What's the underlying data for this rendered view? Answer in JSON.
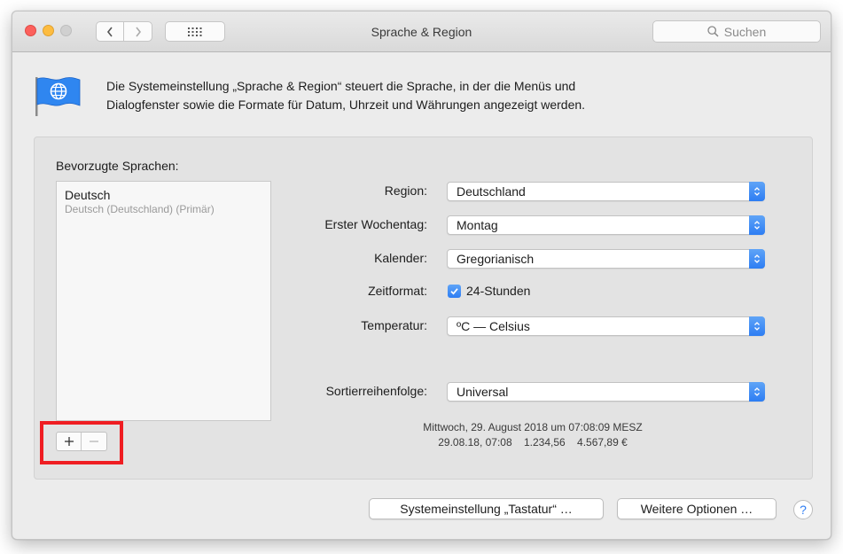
{
  "window": {
    "title": "Sprache & Region",
    "search_placeholder": "Suchen"
  },
  "header": {
    "icon": "flag-globe-icon",
    "description_line1": "Die Systemeinstellung „Sprache & Region“ steuert die Sprache, in der die Menüs und",
    "description_line2": "Dialogfenster sowie die Formate für Datum, Uhrzeit und Währungen angezeigt werden."
  },
  "languages": {
    "title": "Bevorzugte Sprachen:",
    "items": [
      {
        "name": "Deutsch",
        "subtitle": "Deutsch (Deutschland) (Primär)"
      }
    ],
    "add_symbol": "+",
    "remove_symbol": "−"
  },
  "settings": {
    "region_label": "Region:",
    "region_value": "Deutschland",
    "weekday_label": "Erster Wochentag:",
    "weekday_value": "Montag",
    "calendar_label": "Kalender:",
    "calendar_value": "Gregorianisch",
    "timeformat_label": "Zeitformat:",
    "timeformat_checkbox_label": "24-Stunden",
    "timeformat_checked": true,
    "temperature_label": "Temperatur:",
    "temperature_value": "ºC — Celsius",
    "sort_label": "Sortierreihenfolge:",
    "sort_value": "Universal"
  },
  "sample": {
    "line1": "Mittwoch, 29. August 2018 um 07:08:09 MESZ",
    "line2": "29.08.18, 07:08    1.234,56    4.567,89 €"
  },
  "buttons": {
    "keyboard": "Systemeinstellung „Tastatur“ …",
    "advanced": "Weitere Optionen …",
    "help": "?"
  },
  "colors": {
    "accent": "#2d7df3",
    "highlight": "#ef1d22"
  }
}
